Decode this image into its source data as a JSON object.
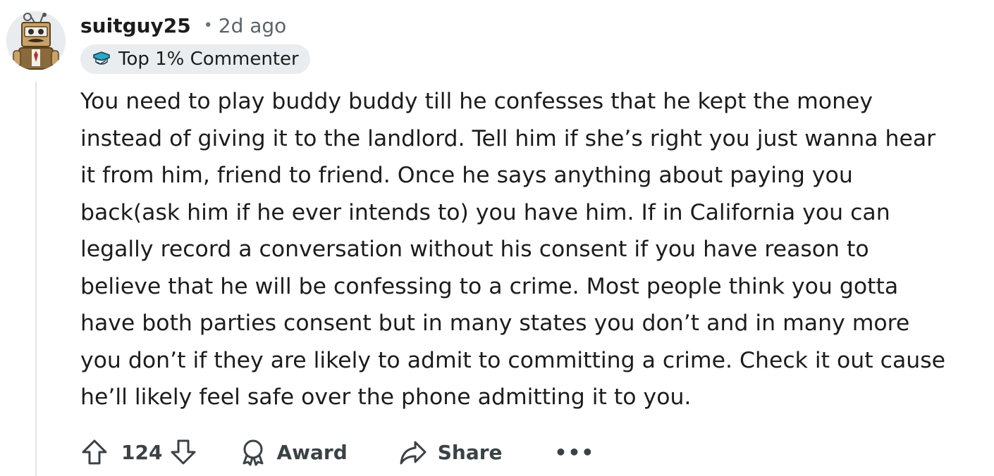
{
  "comment": {
    "username": "suitguy25",
    "separator": "•",
    "timestamp": "2d ago",
    "flair": {
      "label": "Top 1% Commenter",
      "icon": "top-commenter-icon"
    },
    "body": "You need to play buddy buddy till he confesses that he kept the money\ninstead of giving it to the landlord. Tell him if she’s right you just wanna hear\nit from him, friend to friend. Once he says anything about paying you\nback(ask him if he ever intends to) you have him. If in California you can\nlegally record a conversation without his consent if you have reason to\nbelieve that he will be confessing to a crime. Most people think you gotta\nhave both parties consent but in many states you don’t and in many more\nyou don’t if they are likely to admit to committing a crime. Check it out cause\nhe’ll likely feel safe over the phone admitting it to you.",
    "avatar_icon": "avatar-robot-icon"
  },
  "actions": {
    "upvote_icon": "arrow-up-icon",
    "score": "124",
    "downvote_icon": "arrow-down-icon",
    "award_label": "Award",
    "award_icon": "award-icon",
    "share_label": "Share",
    "share_icon": "share-icon",
    "more_label": "•••"
  },
  "colors": {
    "text": "#1c1c1c",
    "muted": "#5c6468",
    "flair_bg": "#eaedef",
    "thread_line": "#e0e4e6",
    "action_text": "#3b4246"
  }
}
